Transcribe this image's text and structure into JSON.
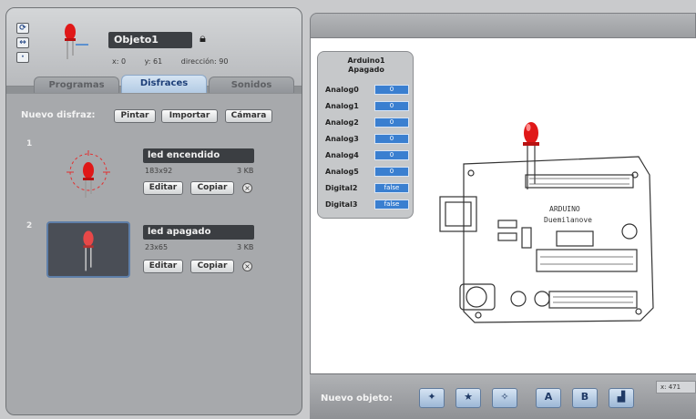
{
  "sprite": {
    "name": "Objeto1",
    "x": "x: 0",
    "y": "y: 61",
    "direction": "dirección: 90"
  },
  "tabs": [
    {
      "label": "Programas",
      "active": false
    },
    {
      "label": "Disfraces",
      "active": true
    },
    {
      "label": "Sonidos",
      "active": false
    }
  ],
  "costumes_panel": {
    "new_label": "Nuevo disfraz:",
    "paint_label": "Pintar",
    "import_label": "Importar",
    "camera_label": "Cámara",
    "costumes": [
      {
        "number": "1",
        "name": "led encendido",
        "size": "183x92",
        "kb": "3 KB",
        "edit_label": "Editar",
        "copy_label": "Copiar"
      },
      {
        "number": "2",
        "name": "led apagado",
        "size": "23x65",
        "kb": "3 KB",
        "edit_label": "Editar",
        "copy_label": "Copiar"
      }
    ]
  },
  "monitor": {
    "title": "Arduino1",
    "subtitle": "Apagado",
    "rows": [
      {
        "label": "Analog0",
        "value": "0"
      },
      {
        "label": "Analog1",
        "value": "0"
      },
      {
        "label": "Analog2",
        "value": "0"
      },
      {
        "label": "Analog3",
        "value": "0"
      },
      {
        "label": "Analog4",
        "value": "0"
      },
      {
        "label": "Analog5",
        "value": "0"
      },
      {
        "label": "Digital2",
        "value": "false"
      },
      {
        "label": "Digital3",
        "value": "false"
      }
    ]
  },
  "board": {
    "label1": "ARDUINO",
    "label2": "Duemilanove"
  },
  "bottom": {
    "new_object_label": "Nuevo objeto:",
    "mouse_readout": "x: 471"
  },
  "colors": {
    "accent": "#3a7fd0",
    "led_red": "#e02020",
    "panel": "#a7a9ac"
  }
}
